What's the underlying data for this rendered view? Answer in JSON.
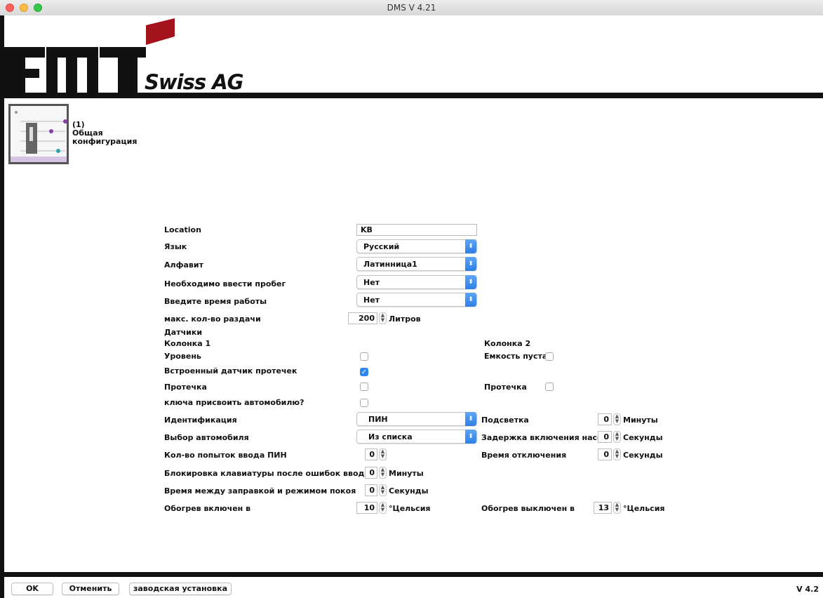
{
  "window": {
    "title": "DMS V 4.21"
  },
  "logo": {
    "brand": "FMT",
    "subtitle": "Swiss AG",
    "accent_color": "#a4121c"
  },
  "module": {
    "number": "(1)",
    "line1": "Общая",
    "line2": "конфигурация"
  },
  "form": {
    "location_label": "Location",
    "location_value": "KB",
    "language_label": "Язык",
    "language_value": "Русский",
    "alphabet_label": "Алфавит",
    "alphabet_value": "Латинница1",
    "mileage_label": "Необходимо ввести пробег",
    "mileage_value": "Нет",
    "worktime_label": "Введите время работы",
    "worktime_value": "Нет",
    "max_dispense_label": "макс. кол-во раздачи",
    "max_dispense_value": "200",
    "max_dispense_unit": "Литров",
    "sensors_heading": "Датчики",
    "column1_heading": "Колонка 1",
    "column2_heading": "Колонка 2",
    "level_label": "Уровень",
    "level_checked": false,
    "tank_empty_label": "Емкость пуста",
    "tank_empty_checked": false,
    "leak_sensor_label": "Встроенный датчик протечек",
    "leak_sensor_checked": true,
    "leak1_label": "Протечка",
    "leak1_checked": false,
    "leak2_label": "Протечка",
    "leak2_checked": false,
    "assign_key_label": "ключа присвоить автомобилю?",
    "assign_key_checked": false,
    "identification_label": "Идентификация",
    "identification_value": "ПИН",
    "backlight_label": "Подсветка",
    "backlight_value": "0",
    "backlight_unit": "Минуты",
    "vehicle_label": "Выбор автомобиля",
    "vehicle_value": "Из списка",
    "pump_delay_label": "Задержка включения насоса",
    "pump_delay_value": "0",
    "pump_delay_unit": "Секунды",
    "pin_attempts_label": "Кол-во попыток ввода ПИН",
    "pin_attempts_value": "0",
    "shutdown_label": "Время отключения",
    "shutdown_value": "0",
    "shutdown_unit": "Секунды",
    "keyboard_lock_label": "Блокировка клавиатуры после ошибок ввода",
    "keyboard_lock_value": "0",
    "keyboard_lock_unit": "Минуты",
    "idle_label": "Время между заправкой и режимом покоя",
    "idle_value": "0",
    "idle_unit": "Секунды",
    "heat_on_label": "Обогрев включен в",
    "heat_on_value": "10",
    "heat_on_unit": "°Цельсия",
    "heat_off_label": "Обогрев выключен в",
    "heat_off_value": "13",
    "heat_off_unit": "°Цельсия"
  },
  "footer": {
    "ok_label": "OK",
    "cancel_label": "Отменить",
    "factory_label": "заводская установка",
    "version": "V 4.2"
  }
}
